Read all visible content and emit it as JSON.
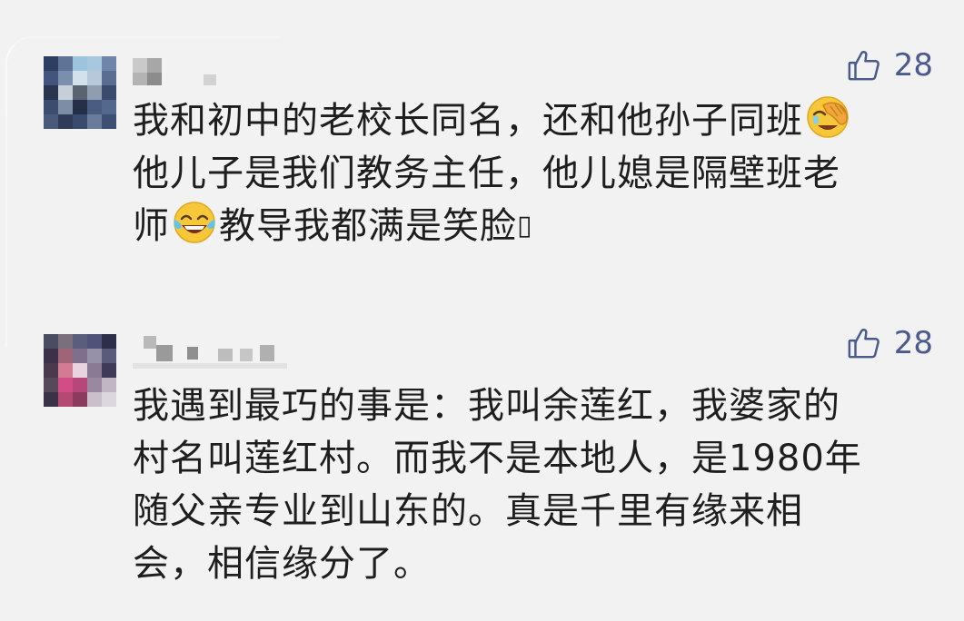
{
  "comments": [
    {
      "likes": "28",
      "lines": [
        {
          "before": "我和初中的老校长同名，还和他孙子同班",
          "emoji": "facepalm-laugh-emoji",
          "after": ""
        },
        {
          "before": "他儿子是我们教务主任，他儿媳是隔壁班老",
          "emoji": "",
          "after": ""
        },
        {
          "before": "师",
          "emoji": "tears-of-joy-emoji",
          "after": "教导我都满是笑脸",
          "tofu": "▯"
        }
      ]
    },
    {
      "likes": "28",
      "lines": [
        {
          "before": "我遇到最巧的事是：我叫余莲红，我婆家的"
        },
        {
          "before": "村名叫莲红村。而我不是本地人，是1980年"
        },
        {
          "before": "随父亲专业到山东的。真是千里有缘来相"
        },
        {
          "before": "会，相信缘分了。"
        }
      ]
    }
  ],
  "colors": {
    "background": "#f2f2f2",
    "like_accent": "#4a5a8c",
    "text": "#1e1e1e"
  },
  "icons": {
    "like": "thumbs-up-icon"
  }
}
